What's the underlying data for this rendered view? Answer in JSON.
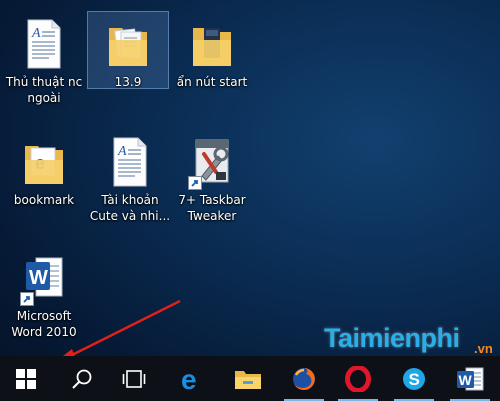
{
  "desktop_icons": [
    {
      "label": "Thủ thuật nc ngoài",
      "icon": "document-icon"
    },
    {
      "label": "13.9",
      "icon": "folder-icon"
    },
    {
      "label": "ẩn nút start",
      "icon": "folder-icon"
    },
    {
      "label": "bookmark",
      "icon": "folder-edge-icon"
    },
    {
      "label": "Tài khoản Cute và nhi...",
      "icon": "document-icon"
    },
    {
      "label": "7+ Taskbar Tweaker",
      "icon": "tools-icon"
    },
    {
      "label": "Microsoft Word 2010",
      "icon": "word-icon"
    }
  ],
  "taskbar": {
    "buttons": [
      {
        "name": "start",
        "icon": "windows-logo-icon"
      },
      {
        "name": "search",
        "icon": "search-icon"
      },
      {
        "name": "task-view",
        "icon": "task-view-icon"
      },
      {
        "name": "edge",
        "icon": "edge-icon"
      },
      {
        "name": "file-explorer",
        "icon": "folder-icon"
      },
      {
        "name": "firefox",
        "icon": "firefox-icon"
      },
      {
        "name": "opera",
        "icon": "opera-icon"
      },
      {
        "name": "skype",
        "icon": "skype-icon"
      },
      {
        "name": "word",
        "icon": "word-icon"
      }
    ]
  },
  "watermark": {
    "brand": "Taimienphi",
    "suffix": ".vn"
  },
  "colors": {
    "taskbar": "#0d1117",
    "arrow": "#e0201b",
    "watermark_brand": "#29aee6",
    "watermark_suffix": "#f28a24",
    "selection": "#78aae6"
  }
}
